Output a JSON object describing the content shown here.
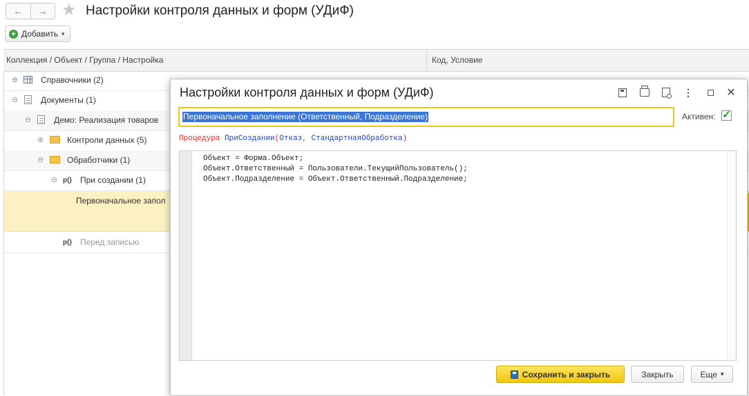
{
  "window": {
    "title": "Настройки контроля данных и форм (УДиФ)",
    "back_glyph": "←",
    "forward_glyph": "→",
    "favorite_glyph": "★"
  },
  "toolbar": {
    "add_label": "Добавить",
    "add_caret": "▾"
  },
  "tree": {
    "columns": [
      "Коллекция / Объект / Группа / Настройка",
      "Код, Условие"
    ],
    "rows": [
      {
        "toggle": "⊕",
        "icon": "table-icon",
        "label": "Справочники (2)"
      },
      {
        "toggle": "⊖",
        "icon": "document-icon",
        "label": "Документы (1)"
      },
      {
        "toggle": "⊖",
        "icon": "document-icon",
        "label": "Демо: Реализация товаров"
      },
      {
        "toggle": "⊕",
        "icon": "folder-icon",
        "label": "Контроли данных (5)"
      },
      {
        "toggle": "⊖",
        "icon": "folder-icon",
        "label": "Обработчики (1)"
      },
      {
        "toggle": "⊖",
        "icon": "procedure-icon",
        "icon_text": "р()",
        "label": "При создании (1)"
      },
      {
        "label": "Первоначальное запол"
      },
      {
        "icon": "procedure-icon",
        "icon_text": "р()",
        "label": "Перед записью"
      }
    ]
  },
  "dialog": {
    "title": "Настройки контроля данных и форм (УДиФ)",
    "name_value": "Первоначальное заполнение (Ответственный, Подразделение)",
    "active_label": "Активен:",
    "active_checked": true,
    "check_glyph": "✓",
    "more_glyph": "⋮",
    "close_glyph": "✕",
    "procedure": {
      "keyword": "Процедура",
      "name": "ПриСоздании",
      "open": "(",
      "param1": "Отказ",
      "comma": ", ",
      "param2": "СтандартнаяОбработка",
      "close": ")"
    },
    "code_lines": [
      "Объект = Форма.Объект;",
      "Объект.Ответственный = Пользователи.ТекущийПользователь();",
      "Объект.Подразделение = Объект.Ответственный.Подразделение;"
    ],
    "buttons": {
      "save_close": "Сохранить и закрыть",
      "close": "Закрыть",
      "more": "Еще",
      "more_caret": "▾"
    }
  },
  "colors": {
    "selection_row": "#fbf1c3",
    "primary_button": "#f1c70e",
    "name_selection": "#3875d7",
    "keyword": "#e8292d",
    "identifier": "#1d3fd1"
  }
}
